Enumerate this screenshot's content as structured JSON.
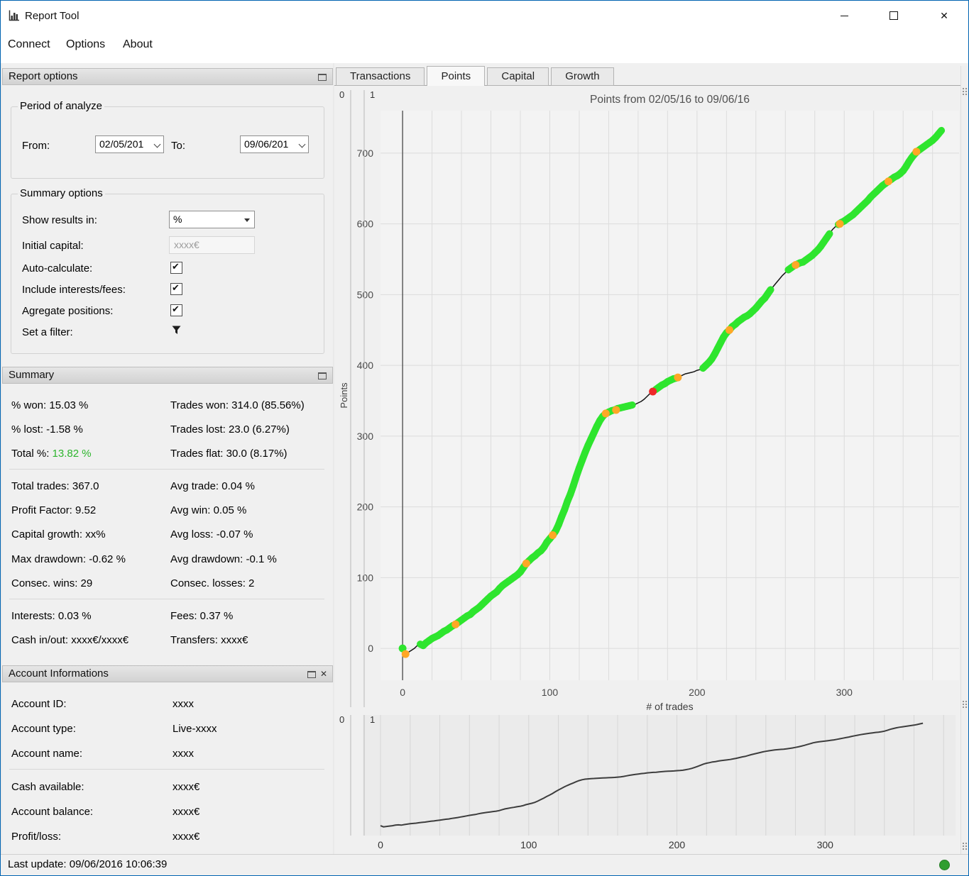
{
  "window": {
    "title": "Report Tool",
    "controls": {
      "close_glyph": "✕"
    }
  },
  "menu": {
    "items": [
      "Connect",
      "Options",
      "About"
    ]
  },
  "toolbar": {
    "icons": [
      "refresh-icon",
      "camera-icon",
      "export-icon"
    ]
  },
  "report_options": {
    "header": "Report options",
    "period": {
      "title": "Period of analyze",
      "from_label": "From:",
      "from_value": "02/05/201",
      "to_label": "To:",
      "to_value": "09/06/201"
    },
    "options": {
      "title": "Summary options",
      "show_results_label": "Show results in:",
      "show_results_value": "%",
      "initial_capital_label": "Initial capital:",
      "initial_capital_value": "xxxx€",
      "auto_calculate_label": "Auto-calculate:",
      "include_fees_label": "Include interests/fees:",
      "agregate_label": "Agregate positions:",
      "filter_label": "Set a filter:"
    }
  },
  "summary": {
    "header": "Summary",
    "rows": [
      {
        "l": "% won: 15.03 %",
        "r": "Trades won: 314.0 (85.56%)"
      },
      {
        "l": "% lost: -1.58 %",
        "r": "Trades lost: 23.0 (6.27%)"
      },
      {
        "l_prefix": "Total %: ",
        "l_value": "13.82 %",
        "r": "Trades flat: 30.0 (8.17%)"
      },
      {
        "l": "Total trades: 367.0",
        "r": "Avg trade: 0.04 %"
      },
      {
        "l": "Profit Factor: 9.52",
        "r": "Avg win: 0.05 %"
      },
      {
        "l": "Capital growth: xx%",
        "r": "Avg loss: -0.07 %"
      },
      {
        "l": "Max drawdown: -0.62 %",
        "r": "Avg drawdown: -0.1 %"
      },
      {
        "l": "Consec. wins: 29",
        "r": "Consec. losses: 2"
      },
      {
        "l": "Interests: 0.03 %",
        "r": "Fees: 0.37 %"
      },
      {
        "l": "Cash in/out: xxxx€/xxxx€",
        "r": "Transfers: xxxx€"
      }
    ]
  },
  "account": {
    "header": "Account Informations",
    "rows": [
      {
        "label": "Account ID:",
        "value": "xxxx"
      },
      {
        "label": "Account type:",
        "value": "Live-xxxx"
      },
      {
        "label": "Account name:",
        "value": "xxxx"
      },
      {
        "label": "Cash available:",
        "value": "xxxx€"
      },
      {
        "label": "Account balance:",
        "value": "xxxx€"
      },
      {
        "label": "Profit/loss:",
        "value": "xxxx€"
      }
    ]
  },
  "status": {
    "text": "Last update: 09/06/2016 10:06:39"
  },
  "tabs": {
    "items": [
      "Transactions",
      "Points",
      "Capital",
      "Growth"
    ],
    "active": "Points"
  },
  "chart_data": {
    "type": "scatter",
    "title": "Points from 02/05/16 to 09/06/16",
    "xlabel": "# of trades",
    "ylabel": "Points",
    "xlim": [
      -15,
      378
    ],
    "ylim": [
      -45,
      760
    ],
    "xticks": [
      0,
      100,
      200,
      300
    ],
    "yticks": [
      0,
      100,
      200,
      300,
      400,
      500,
      600,
      700
    ],
    "grid_step_x": 20,
    "slider_labels": [
      "0",
      "1"
    ],
    "colors": {
      "line": "#141414",
      "win": "#2ee52e",
      "flat": "#ffa726",
      "loss": "#ef2929",
      "nav_line": "#3d3d3d"
    },
    "series": {
      "points": [
        [
          0,
          0
        ],
        [
          2,
          -8
        ],
        [
          5,
          -4
        ],
        [
          8,
          0
        ],
        [
          10,
          4
        ],
        [
          12,
          6
        ],
        [
          14,
          4
        ],
        [
          16,
          8
        ],
        [
          18,
          11
        ],
        [
          20,
          14
        ],
        [
          22,
          16
        ],
        [
          24,
          18
        ],
        [
          26,
          21
        ],
        [
          28,
          24
        ],
        [
          30,
          26
        ],
        [
          32,
          29
        ],
        [
          34,
          32
        ],
        [
          36,
          34
        ],
        [
          38,
          37
        ],
        [
          40,
          40
        ],
        [
          42,
          43
        ],
        [
          44,
          46
        ],
        [
          46,
          48
        ],
        [
          48,
          52
        ],
        [
          50,
          55
        ],
        [
          52,
          58
        ],
        [
          54,
          62
        ],
        [
          56,
          66
        ],
        [
          58,
          70
        ],
        [
          60,
          74
        ],
        [
          62,
          77
        ],
        [
          64,
          80
        ],
        [
          66,
          85
        ],
        [
          68,
          89
        ],
        [
          70,
          92
        ],
        [
          72,
          95
        ],
        [
          74,
          98
        ],
        [
          76,
          101
        ],
        [
          78,
          104
        ],
        [
          80,
          108
        ],
        [
          82,
          114
        ],
        [
          84,
          120
        ],
        [
          86,
          124
        ],
        [
          88,
          128
        ],
        [
          90,
          131
        ],
        [
          92,
          135
        ],
        [
          94,
          138
        ],
        [
          96,
          143
        ],
        [
          98,
          150
        ],
        [
          100,
          155
        ],
        [
          102,
          160
        ],
        [
          104,
          166
        ],
        [
          106,
          175
        ],
        [
          108,
          186
        ],
        [
          110,
          196
        ],
        [
          112,
          208
        ],
        [
          114,
          218
        ],
        [
          116,
          230
        ],
        [
          118,
          243
        ],
        [
          120,
          255
        ],
        [
          122,
          266
        ],
        [
          124,
          277
        ],
        [
          126,
          287
        ],
        [
          128,
          296
        ],
        [
          130,
          305
        ],
        [
          132,
          314
        ],
        [
          134,
          322
        ],
        [
          136,
          328
        ],
        [
          138,
          332
        ],
        [
          140,
          334
        ],
        [
          142,
          336
        ],
        [
          144,
          337
        ],
        [
          146,
          339
        ],
        [
          148,
          340
        ],
        [
          150,
          341
        ],
        [
          152,
          342
        ],
        [
          154,
          343
        ],
        [
          156,
          344
        ],
        [
          158,
          345
        ],
        [
          160,
          347
        ],
        [
          162,
          349
        ],
        [
          164,
          352
        ],
        [
          166,
          356
        ],
        [
          168,
          360
        ],
        [
          170,
          363
        ],
        [
          172,
          366
        ],
        [
          174,
          369
        ],
        [
          176,
          372
        ],
        [
          178,
          374
        ],
        [
          180,
          377
        ],
        [
          182,
          379
        ],
        [
          184,
          381
        ],
        [
          186,
          382
        ],
        [
          188,
          384
        ],
        [
          190,
          386
        ],
        [
          192,
          388
        ],
        [
          194,
          389
        ],
        [
          196,
          390
        ],
        [
          198,
          391
        ],
        [
          200,
          393
        ],
        [
          202,
          394
        ],
        [
          204,
          396
        ],
        [
          206,
          400
        ],
        [
          208,
          404
        ],
        [
          210,
          409
        ],
        [
          212,
          416
        ],
        [
          214,
          424
        ],
        [
          216,
          432
        ],
        [
          218,
          440
        ],
        [
          220,
          446
        ],
        [
          222,
          450
        ],
        [
          224,
          455
        ],
        [
          226,
          458
        ],
        [
          228,
          462
        ],
        [
          230,
          465
        ],
        [
          232,
          468
        ],
        [
          234,
          470
        ],
        [
          236,
          473
        ],
        [
          238,
          477
        ],
        [
          240,
          481
        ],
        [
          242,
          486
        ],
        [
          244,
          491
        ],
        [
          246,
          495
        ],
        [
          248,
          501
        ],
        [
          250,
          507
        ],
        [
          252,
          512
        ],
        [
          254,
          517
        ],
        [
          256,
          522
        ],
        [
          258,
          527
        ],
        [
          260,
          531
        ],
        [
          262,
          535
        ],
        [
          264,
          538
        ],
        [
          266,
          541
        ],
        [
          268,
          543
        ],
        [
          270,
          545
        ],
        [
          272,
          546
        ],
        [
          274,
          549
        ],
        [
          276,
          552
        ],
        [
          278,
          555
        ],
        [
          280,
          559
        ],
        [
          282,
          563
        ],
        [
          284,
          568
        ],
        [
          286,
          574
        ],
        [
          288,
          580
        ],
        [
          290,
          586
        ],
        [
          292,
          592
        ],
        [
          294,
          596
        ],
        [
          296,
          599
        ],
        [
          298,
          602
        ],
        [
          300,
          604
        ],
        [
          302,
          607
        ],
        [
          304,
          610
        ],
        [
          306,
          613
        ],
        [
          308,
          617
        ],
        [
          310,
          621
        ],
        [
          312,
          625
        ],
        [
          314,
          629
        ],
        [
          316,
          633
        ],
        [
          318,
          638
        ],
        [
          320,
          642
        ],
        [
          322,
          646
        ],
        [
          324,
          650
        ],
        [
          326,
          654
        ],
        [
          328,
          657
        ],
        [
          330,
          660
        ],
        [
          332,
          663
        ],
        [
          334,
          666
        ],
        [
          336,
          668
        ],
        [
          338,
          671
        ],
        [
          340,
          675
        ],
        [
          342,
          681
        ],
        [
          344,
          688
        ],
        [
          346,
          694
        ],
        [
          348,
          699
        ],
        [
          350,
          703
        ],
        [
          352,
          706
        ],
        [
          354,
          709
        ],
        [
          356,
          712
        ],
        [
          358,
          715
        ],
        [
          360,
          718
        ],
        [
          362,
          722
        ],
        [
          364,
          727
        ],
        [
          366,
          732
        ]
      ],
      "green_gaps": [
        [
          1,
          11
        ],
        [
          156,
          172
        ],
        [
          187,
          204
        ],
        [
          250,
          262
        ],
        [
          291,
          296
        ]
      ],
      "flat_points": [
        [
          2,
          -8
        ],
        [
          36,
          34
        ],
        [
          84,
          120
        ],
        [
          102,
          160
        ],
        [
          138,
          332
        ],
        [
          145,
          337
        ],
        [
          187,
          383
        ],
        [
          222,
          450
        ],
        [
          267,
          542
        ],
        [
          297,
          600
        ],
        [
          330,
          660
        ],
        [
          349,
          702
        ]
      ],
      "loss_points": [
        [
          170,
          363
        ]
      ],
      "start_green": [
        [
          0,
          0
        ]
      ]
    },
    "navigator": {
      "xticks": [
        0,
        100,
        200,
        300
      ],
      "slider_labels": [
        "0",
        "1"
      ]
    }
  }
}
